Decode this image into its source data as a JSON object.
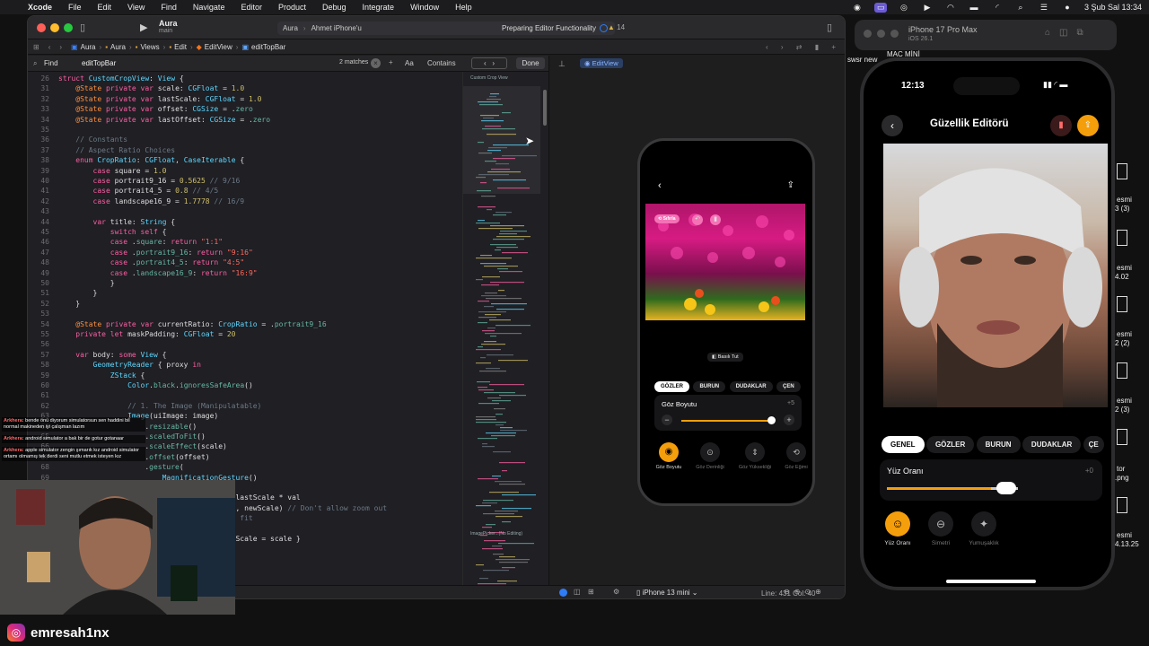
{
  "menubar": {
    "app": "Xcode",
    "items": [
      "File",
      "Edit",
      "View",
      "Find",
      "Navigate",
      "Editor",
      "Product",
      "Debug",
      "Integrate",
      "Window",
      "Help"
    ],
    "datetime": "3 Şub Sal  13:34"
  },
  "titlebar": {
    "project": "Aura",
    "branch": "main",
    "scheme": "Aura",
    "destination": "Ahmet iPhone'u",
    "status": "Preparing Editor Functionality",
    "warnings": "14"
  },
  "breadcrumb": [
    "Aura",
    "Aura",
    "Views",
    "Edit",
    "EditView",
    "editTopBar"
  ],
  "find": {
    "mode": "Find",
    "query": "editTopBar",
    "matches": "2 matches",
    "case_label": "Aa",
    "match_type": "Contains",
    "done": "Done"
  },
  "canvas": {
    "tab": "EditView",
    "device": "iPhone 13 mini"
  },
  "code_lines": [
    {
      "n": "26",
      "t": [
        [
          "kw",
          "struct "
        ],
        [
          "ty",
          "CustomCropView"
        ],
        [
          "pl",
          ": "
        ],
        [
          "ty",
          "View"
        ],
        [
          "pl",
          " {"
        ]
      ]
    },
    {
      "n": "31",
      "t": [
        [
          "pl",
          "    "
        ],
        [
          "at",
          "@State"
        ],
        [
          "kw",
          " private var "
        ],
        [
          "pl",
          "scale"
        ],
        [
          "pl",
          ": "
        ],
        [
          "ty",
          "CGFloat"
        ],
        [
          "pl",
          " = "
        ],
        [
          "nu",
          "1.0"
        ]
      ]
    },
    {
      "n": "32",
      "t": [
        [
          "pl",
          "    "
        ],
        [
          "at",
          "@State"
        ],
        [
          "kw",
          " private var "
        ],
        [
          "pl",
          "lastScale"
        ],
        [
          "pl",
          ": "
        ],
        [
          "ty",
          "CGFloat"
        ],
        [
          "pl",
          " = "
        ],
        [
          "nu",
          "1.0"
        ]
      ]
    },
    {
      "n": "33",
      "t": [
        [
          "pl",
          "    "
        ],
        [
          "at",
          "@State"
        ],
        [
          "kw",
          " private var "
        ],
        [
          "pl",
          "offset"
        ],
        [
          "pl",
          ": "
        ],
        [
          "ty",
          "CGSize"
        ],
        [
          "pl",
          " = ."
        ],
        [
          "fn",
          "zero"
        ]
      ]
    },
    {
      "n": "34",
      "t": [
        [
          "pl",
          "    "
        ],
        [
          "at",
          "@State"
        ],
        [
          "kw",
          " private var "
        ],
        [
          "pl",
          "lastOffset"
        ],
        [
          "pl",
          ": "
        ],
        [
          "ty",
          "CGSize"
        ],
        [
          "pl",
          " = ."
        ],
        [
          "fn",
          "zero"
        ]
      ]
    },
    {
      "n": "35",
      "t": []
    },
    {
      "n": "36",
      "t": [
        [
          "cm",
          "    // Constants"
        ]
      ]
    },
    {
      "n": "37",
      "t": [
        [
          "cm",
          "    // Aspect Ratio Choices"
        ]
      ]
    },
    {
      "n": "38",
      "t": [
        [
          "pl",
          "    "
        ],
        [
          "kw",
          "enum "
        ],
        [
          "ty",
          "CropRatio"
        ],
        [
          "pl",
          ": "
        ],
        [
          "ty",
          "CGFloat"
        ],
        [
          "pl",
          ", "
        ],
        [
          "ty",
          "CaseIterable"
        ],
        [
          "pl",
          " {"
        ]
      ]
    },
    {
      "n": "39",
      "t": [
        [
          "pl",
          "        "
        ],
        [
          "kw",
          "case "
        ],
        [
          "pl",
          "square = "
        ],
        [
          "nu",
          "1.0"
        ]
      ]
    },
    {
      "n": "40",
      "t": [
        [
          "pl",
          "        "
        ],
        [
          "kw",
          "case "
        ],
        [
          "pl",
          "portrait9_16 = "
        ],
        [
          "nu",
          "0.5625"
        ],
        [
          "cm",
          " // 9/16"
        ]
      ]
    },
    {
      "n": "41",
      "t": [
        [
          "pl",
          "        "
        ],
        [
          "kw",
          "case "
        ],
        [
          "pl",
          "portrait4_5 = "
        ],
        [
          "nu",
          "0.8"
        ],
        [
          "cm",
          " // 4/5"
        ]
      ]
    },
    {
      "n": "42",
      "t": [
        [
          "pl",
          "        "
        ],
        [
          "kw",
          "case "
        ],
        [
          "pl",
          "landscape16_9 = "
        ],
        [
          "nu",
          "1.7778"
        ],
        [
          "cm",
          " // 16/9"
        ]
      ]
    },
    {
      "n": "43",
      "t": []
    },
    {
      "n": "44",
      "t": [
        [
          "pl",
          "        "
        ],
        [
          "kw",
          "var "
        ],
        [
          "pl",
          "title: "
        ],
        [
          "ty",
          "String"
        ],
        [
          "pl",
          " {"
        ]
      ]
    },
    {
      "n": "45",
      "t": [
        [
          "pl",
          "            "
        ],
        [
          "kw",
          "switch self "
        ],
        [
          "pl",
          "{"
        ]
      ]
    },
    {
      "n": "46",
      "t": [
        [
          "pl",
          "            "
        ],
        [
          "kw",
          "case "
        ],
        [
          "pl",
          "."
        ],
        [
          "fn",
          "square"
        ],
        [
          "pl",
          ": "
        ],
        [
          "kw",
          "return "
        ],
        [
          "st",
          "\"1:1\""
        ]
      ]
    },
    {
      "n": "47",
      "t": [
        [
          "pl",
          "            "
        ],
        [
          "kw",
          "case "
        ],
        [
          "pl",
          "."
        ],
        [
          "fn",
          "portrait9_16"
        ],
        [
          "pl",
          ": "
        ],
        [
          "kw",
          "return "
        ],
        [
          "st",
          "\"9:16\""
        ]
      ]
    },
    {
      "n": "48",
      "t": [
        [
          "pl",
          "            "
        ],
        [
          "kw",
          "case "
        ],
        [
          "pl",
          "."
        ],
        [
          "fn",
          "portrait4_5"
        ],
        [
          "pl",
          ": "
        ],
        [
          "kw",
          "return "
        ],
        [
          "st",
          "\"4:5\""
        ]
      ]
    },
    {
      "n": "49",
      "t": [
        [
          "pl",
          "            "
        ],
        [
          "kw",
          "case "
        ],
        [
          "pl",
          "."
        ],
        [
          "fn",
          "landscape16_9"
        ],
        [
          "pl",
          ": "
        ],
        [
          "kw",
          "return "
        ],
        [
          "st",
          "\"16:9\""
        ]
      ]
    },
    {
      "n": "50",
      "t": [
        [
          "pl",
          "            }"
        ]
      ]
    },
    {
      "n": "51",
      "t": [
        [
          "pl",
          "        }"
        ]
      ]
    },
    {
      "n": "52",
      "t": [
        [
          "pl",
          "    }"
        ]
      ]
    },
    {
      "n": "53",
      "t": []
    },
    {
      "n": "54",
      "t": [
        [
          "pl",
          "    "
        ],
        [
          "at",
          "@State"
        ],
        [
          "kw",
          " private var "
        ],
        [
          "pl",
          "currentRatio: "
        ],
        [
          "ty",
          "CropRatio"
        ],
        [
          "pl",
          " = ."
        ],
        [
          "fn",
          "portrait9_16"
        ]
      ]
    },
    {
      "n": "55",
      "t": [
        [
          "pl",
          "    "
        ],
        [
          "kw",
          "private let "
        ],
        [
          "pl",
          "maskPadding: "
        ],
        [
          "ty",
          "CGFloat"
        ],
        [
          "pl",
          " = "
        ],
        [
          "nu",
          "20"
        ]
      ]
    },
    {
      "n": "56",
      "t": []
    },
    {
      "n": "57",
      "t": [
        [
          "pl",
          "    "
        ],
        [
          "kw",
          "var "
        ],
        [
          "pl",
          "body: "
        ],
        [
          "kw",
          "some "
        ],
        [
          "ty",
          "View"
        ],
        [
          "pl",
          " {"
        ]
      ]
    },
    {
      "n": "58",
      "t": [
        [
          "pl",
          "        "
        ],
        [
          "ty",
          "GeometryReader"
        ],
        [
          "pl",
          " { proxy "
        ],
        [
          "kw",
          "in"
        ]
      ]
    },
    {
      "n": "59",
      "t": [
        [
          "pl",
          "            "
        ],
        [
          "ty",
          "ZStack"
        ],
        [
          "pl",
          " {"
        ]
      ]
    },
    {
      "n": "60",
      "t": [
        [
          "pl",
          "                "
        ],
        [
          "ty",
          "Color"
        ],
        [
          "pl",
          "."
        ],
        [
          "fn",
          "black"
        ],
        [
          "pl",
          "."
        ],
        [
          "fn",
          "ignoresSafeArea"
        ],
        [
          "pl",
          "()"
        ]
      ]
    },
    {
      "n": "61",
      "t": []
    },
    {
      "n": "62",
      "t": [
        [
          "cm",
          "                // 1. The Image (Manipulatable)"
        ]
      ]
    },
    {
      "n": "63",
      "t": [
        [
          "pl",
          "                "
        ],
        [
          "ty",
          "Image"
        ],
        [
          "pl",
          "(uiImage: image)"
        ]
      ]
    },
    {
      "n": "64",
      "t": [
        [
          "pl",
          "                    ."
        ],
        [
          "fn",
          "resizable"
        ],
        [
          "pl",
          "()"
        ]
      ]
    },
    {
      "n": "65",
      "t": [
        [
          "pl",
          "                    ."
        ],
        [
          "fn",
          "scaledToFit"
        ],
        [
          "pl",
          "()"
        ]
      ]
    },
    {
      "n": "66",
      "t": [
        [
          "pl",
          "                    ."
        ],
        [
          "fn",
          "scaleEffect"
        ],
        [
          "pl",
          "(scale)"
        ]
      ]
    },
    {
      "n": "67",
      "t": [
        [
          "pl",
          "                    ."
        ],
        [
          "fn",
          "offset"
        ],
        [
          "pl",
          "(offset)"
        ]
      ]
    },
    {
      "n": "68",
      "t": [
        [
          "pl",
          "                    ."
        ],
        [
          "fn",
          "gesture"
        ],
        [
          "pl",
          "("
        ]
      ]
    },
    {
      "n": "69",
      "t": [
        [
          "pl",
          "                        "
        ],
        [
          "ty",
          "MagnificationGesture"
        ],
        [
          "pl",
          "()"
        ]
      ]
    },
    {
      "n": "70",
      "t": [
        [
          "pl",
          "                                  val "
        ],
        [
          "kw",
          "in"
        ]
      ]
    },
    {
      "n": "71",
      "t": [
        [
          "pl",
          "                                  cale = lastScale * val"
        ]
      ]
    },
    {
      "n": "72",
      "t": [
        [
          "pl",
          "                                  "
        ],
        [
          "fn",
          "max"
        ],
        [
          "pl",
          "("
        ],
        [
          "nu",
          "1.0"
        ],
        [
          "pl",
          ", newScale) "
        ],
        [
          "cm",
          "// Don't allow zoom out"
        ]
      ]
    },
    {
      "n": "73",
      "t": [
        [
          "cm",
          "                                  er than fit"
        ]
      ]
    },
    {
      "n": "74",
      "t": []
    },
    {
      "n": "75",
      "t": [
        [
          "pl",
          "                                  "
        ],
        [
          "kw",
          "in "
        ],
        [
          "pl",
          "lastScale = scale }"
        ]
      ]
    },
    {
      "n": "76",
      "t": []
    },
    {
      "n": "77",
      "t": []
    },
    {
      "n": "78",
      "t": []
    },
    {
      "n": "79",
      "t": [
        [
          "pl",
          "                                  val "
        ],
        [
          "kw",
          "in"
        ]
      ]
    }
  ],
  "minimap": {
    "label1": "Custom Crop View",
    "label2": "ImagePicker...(No Editing)"
  },
  "preview_phone": {
    "reset": "Sıfırla",
    "hold": "Basılı Tut",
    "tabs": [
      "GÖZLER",
      "BURUN",
      "DUDAKLAR",
      "ÇEN"
    ],
    "slider_title": "Göz Boyutu",
    "slider_value": "+5",
    "tools": [
      "Göz Boyutu",
      "Göz Derinliği",
      "Göz Yüksekliği",
      "Göz Eğimi"
    ]
  },
  "statusbar": {
    "position": "Line: 431  Col: 40"
  },
  "simulator": {
    "device": "iPhone 17 Pro Max",
    "os": "iOS 26.1",
    "time": "12:13",
    "title": "Güzellik Editörü",
    "tabs": [
      "GENEL",
      "GÖZLER",
      "BURUN",
      "DUDAKLAR",
      "ÇE"
    ],
    "slider_title": "Yüz Oranı",
    "slider_value": "+0",
    "tools": [
      "Yüz Oranı",
      "Simetri",
      "Yumuşaklık"
    ]
  },
  "desktop_files": [
    "swsr new",
    "MAC MİNİ",
    "esmi",
    "3 (3)",
    "esmi",
    "4.02",
    "esmi",
    "2 (2)",
    "esmi",
    "2 (3)",
    "tor",
    ".png",
    "esmi",
    "4.13.25"
  ],
  "chat": [
    {
      "name": "Arkhera:",
      "text": "bende önü diyorum simulatorsun sen haddini bil normal makineden iyi çalışman lazım"
    },
    {
      "name": "Arkhera:",
      "text": "android simulator a bak bir de gotur gotanaar"
    },
    {
      "name": "Arkhera:",
      "text": "apple simulator zengin şımarık kız android simulator ortamı olmamış tek derdi seni mutlu etmek isteyen kız"
    }
  ],
  "streamer": {
    "handle": "emresah1nx"
  },
  "colors": {
    "accent_orange": "#f59e0b",
    "xcode_blue": "#2f7cf6",
    "pink": "#e11d74"
  }
}
